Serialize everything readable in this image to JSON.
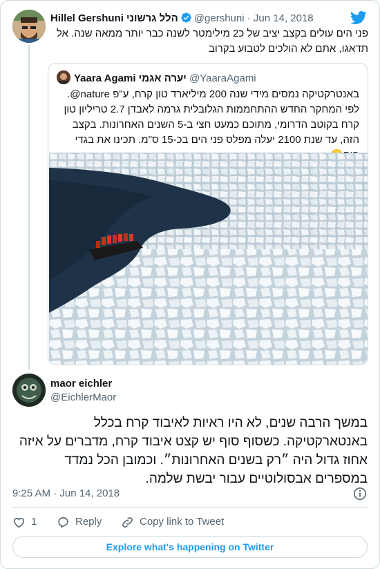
{
  "parent": {
    "display_name": "Hillel Gershuni הלל גרשוני",
    "handle": "@gershuni",
    "separator": "·",
    "date": "Jun 14, 2018",
    "text": "פני הים עולים בקצב יציב של כ2 מילימטר לשנה כבר יותר ממאה שנה. אל תדאגו, אתם לא הולכים לטבוע בקרוב"
  },
  "quoted": {
    "display_name": "Yaara Agami יערה אגמי",
    "handle": "@YaaraAgami",
    "text": "באנטרקטיקה נמסים מידי שנה 200 מיליארד טון קרח, ע\"פ nature@. לפי המחקר החדש ההתחממות הגלובלית גרמה לאבדן 2.7 טריליון טון קרח בקוטב הדרומי, מתוכם כמעט חצי ב-5 השנים האחרונות. בקצב הזה, עד שנת 2100 יעלה מפלס פני הים בכ-15 ס\"מ. תכינו את בגדי הים☹️"
  },
  "reply": {
    "display_name": "maor eichler",
    "handle": "@EichlerMaor",
    "text": "במשך הרבה שנים, לא היו ראיות לאיבוד קרח בכלל באנטארקטיקה. כשסוף סוף יש קצט איבוד קרח, מדברים על איזה אחוז גדול היה ״רק בשנים האחרונות״. וכמובן הכל נמדד במספרים אבסולוטיים עבור יבשת שלמה.",
    "timestamp": "9:25 AM · Jun 14, 2018"
  },
  "actions": {
    "like_count": "1",
    "reply_label": "Reply",
    "copy_label": "Copy link to Tweet"
  },
  "footer": {
    "explore_label": "Explore what's happening on Twitter"
  },
  "colors": {
    "accent": "#1d9bf0",
    "text_secondary": "#536471",
    "border": "#cfd9de"
  },
  "icons": [
    "twitter-bird-icon",
    "verified-badge-icon",
    "info-icon",
    "heart-icon",
    "reply-icon",
    "link-icon"
  ]
}
